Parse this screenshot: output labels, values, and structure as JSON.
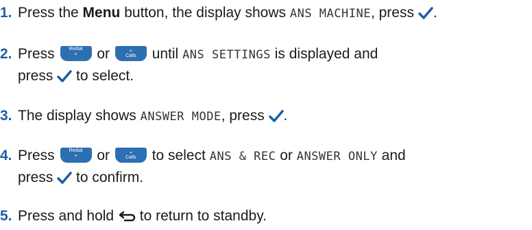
{
  "steps": {
    "s1": {
      "num": "1.",
      "t1": "Press the ",
      "menu": "Menu",
      "t2": " button, the display shows ",
      "lcd1": "ANS MACHINE",
      "t3": ", press ",
      "t4": "."
    },
    "s2": {
      "num": "2.",
      "t1": "Press ",
      "t2": " or ",
      "t3": " until ",
      "lcd1": "ANS SETTINGS",
      "t4": " is displayed and",
      "line2a": "press ",
      "line2b": " to select."
    },
    "s3": {
      "num": "3.",
      "t1": "The display shows ",
      "lcd1": "ANSWER MODE",
      "t2": ", press ",
      "t3": "."
    },
    "s4": {
      "num": "4.",
      "t1": "Press ",
      "t2": " or ",
      "t3": " to select ",
      "lcd1": "ANS & REC",
      "t4": " or ",
      "lcd2": "ANSWER ONLY",
      "t5": " and",
      "line2a": "press ",
      "line2b": " to confirm."
    },
    "s5": {
      "num": "5.",
      "t1": "Press and hold ",
      "t2": " to return to standby."
    }
  },
  "keys": {
    "redial": "Redial",
    "calls": "Calls"
  },
  "icons": {
    "confirm": "checkmark-icon",
    "up": "up-key-icon",
    "down": "down-key-icon",
    "back": "back-icon"
  },
  "colors": {
    "number": "#1a5fa6",
    "key": "#2d6fb3",
    "check": "#1a5fa6"
  }
}
